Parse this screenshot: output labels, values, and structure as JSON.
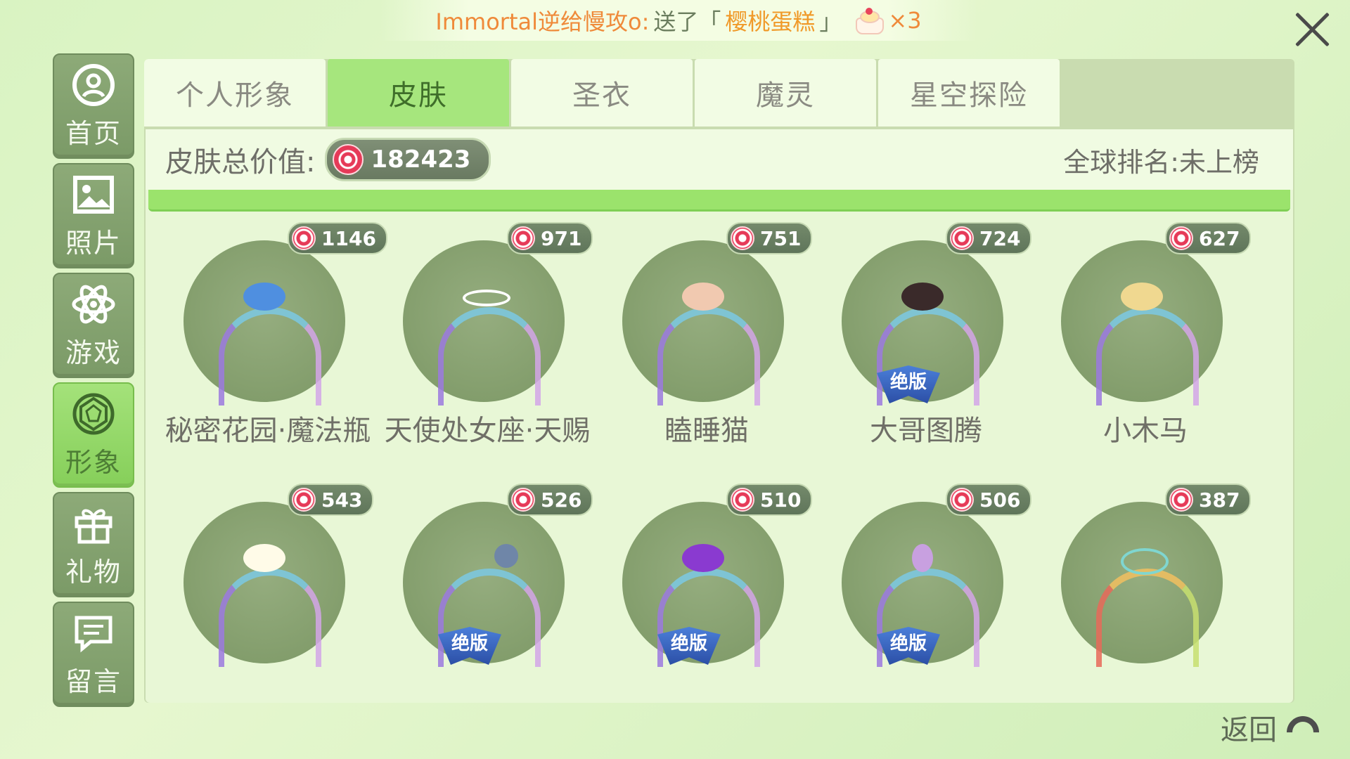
{
  "banner": {
    "sender": "Immortal逆给慢攻o:",
    "message": "送了「",
    "gift": "樱桃蛋糕",
    "message_end": "」",
    "count": "×3"
  },
  "sidebar": {
    "items": [
      {
        "label": "首页",
        "icon": "home-icon"
      },
      {
        "label": "照片",
        "icon": "photo-icon"
      },
      {
        "label": "游戏",
        "icon": "atom-icon"
      },
      {
        "label": "形象",
        "icon": "gem-icon"
      },
      {
        "label": "礼物",
        "icon": "gift-icon"
      },
      {
        "label": "留言",
        "icon": "message-icon"
      }
    ],
    "active_index": 3
  },
  "tabs": [
    {
      "label": "个人形象"
    },
    {
      "label": "皮肤"
    },
    {
      "label": "圣衣"
    },
    {
      "label": "魔灵"
    },
    {
      "label": "星空探险"
    }
  ],
  "summary": {
    "label": "皮肤总价值:",
    "total_value": "182423",
    "rank": "全球排名:未上榜"
  },
  "skins": [
    {
      "name": "秘密花园·魔法瓶",
      "price": "1146",
      "limited": false
    },
    {
      "name": "天使处女座·天赐",
      "price": "971",
      "limited": false
    },
    {
      "name": "瞌睡猫",
      "price": "751",
      "limited": false
    },
    {
      "name": "大哥图腾",
      "price": "724",
      "limited": true
    },
    {
      "name": "小木马",
      "price": "627",
      "limited": false
    },
    {
      "name": "",
      "price": "543",
      "limited": false
    },
    {
      "name": "",
      "price": "526",
      "limited": true
    },
    {
      "name": "",
      "price": "510",
      "limited": true
    },
    {
      "name": "",
      "price": "506",
      "limited": true
    },
    {
      "name": "",
      "price": "387",
      "limited": false
    }
  ],
  "limited_label": "绝版",
  "back_label": "返回",
  "colors": {
    "accent_green": "#a6e67d",
    "currency_red": "#e63a58"
  }
}
